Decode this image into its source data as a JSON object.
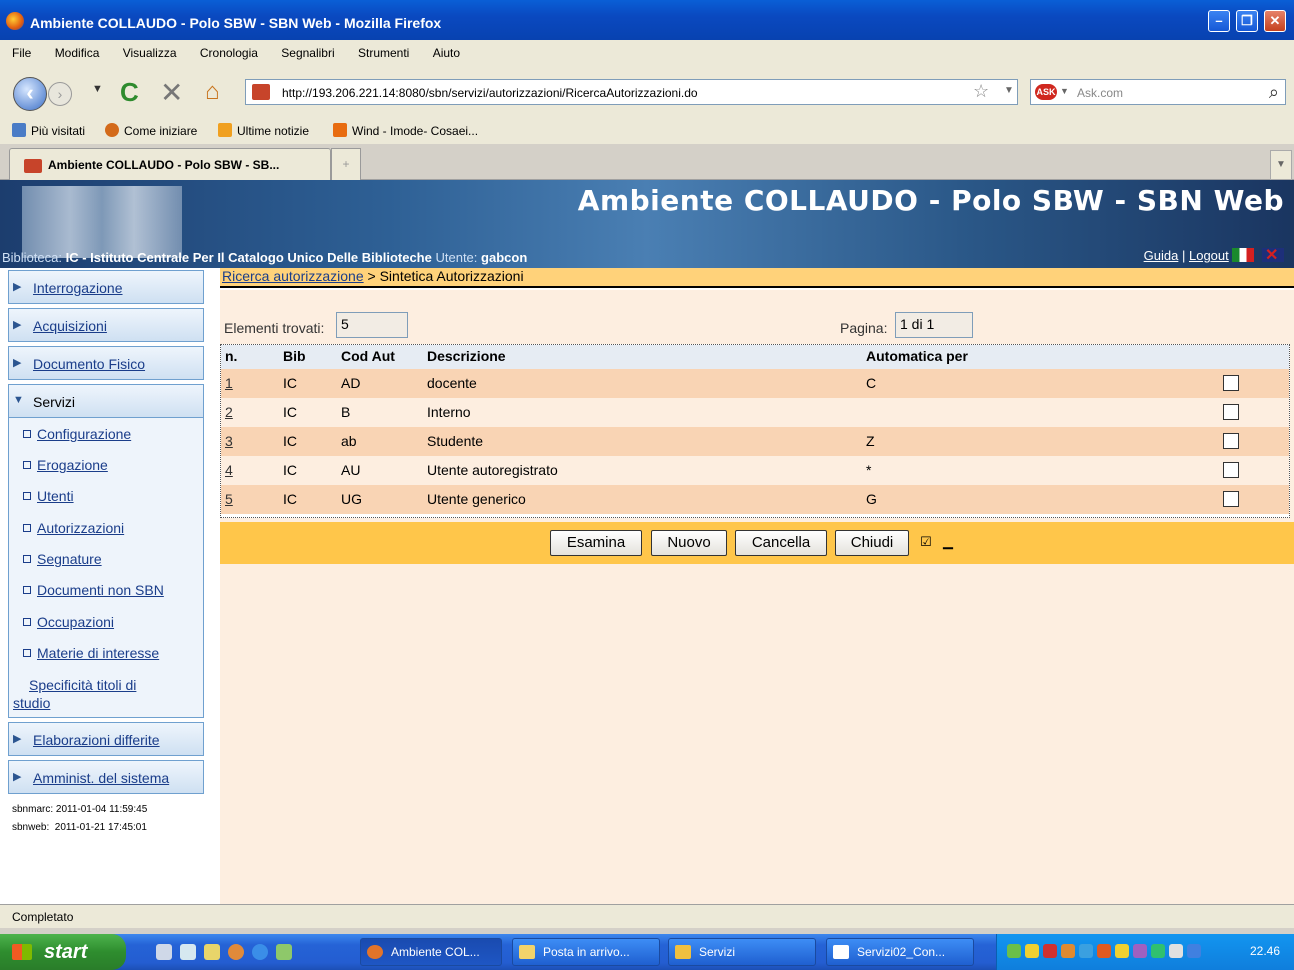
{
  "window": {
    "title": "Ambiente COLLAUDO - Polo SBW - SBN Web - Mozilla Firefox",
    "min": "–",
    "max": "❐",
    "close": "✕"
  },
  "menu": [
    "File",
    "Modifica",
    "Visualizza",
    "Cronologia",
    "Segnalibri",
    "Strumenti",
    "Aiuto"
  ],
  "nav": {
    "url": "http://193.206.221.14:8080/sbn/servizi/autorizzazioni/RicercaAutorizzazioni.do",
    "search_placeholder": "Ask.com",
    "search_logo": "ASK"
  },
  "bookmarks": [
    "Più visitati",
    "Come iniziare",
    "Ultime notizie",
    "Wind - Imode- Cosaei..."
  ],
  "tab": {
    "label": "Ambiente COLLAUDO - Polo SBW - SB...",
    "new": "+"
  },
  "banner": {
    "title": "Ambiente COLLAUDO - Polo SBW - SBN Web",
    "biblioteca_label": "Biblioteca:",
    "biblioteca_code": "IC",
    "biblioteca_name": "- Istituto Centrale Per Il Catalogo Unico Delle Biblioteche",
    "utente_label": "Utente:",
    "utente": "gabcon",
    "guida": "Guida",
    "sep": "|",
    "logout": "Logout"
  },
  "sidebar": {
    "items_top": [
      "Interrogazione",
      "Acquisizioni",
      "Documento Fisico"
    ],
    "servizi": "Servizi",
    "sub": [
      "Configurazione",
      "Erogazione",
      "Utenti",
      "Autorizzazioni",
      "Segnature",
      "Documenti non SBN",
      "Occupazioni",
      "Materie di interesse"
    ],
    "sub_multi_1": "Specificità titoli di",
    "sub_multi_2": "studio",
    "items_bottom": [
      "Elaborazioni differite",
      "Amminist. del sistema"
    ],
    "versions": [
      "sbnmarc: 2011-01-04 11:59:45",
      "sbnweb:  2011-01-21 17:45:01"
    ]
  },
  "breadcrumb": {
    "link": "Ricerca autorizzazione",
    "sep": ">",
    "current": "Sintetica Autorizzazioni"
  },
  "results": {
    "found_label": "Elementi trovati:",
    "found": "5",
    "page_label": "Pagina:",
    "page": "1 di 1"
  },
  "table": {
    "headers": [
      "n.",
      "Bib",
      "Cod Aut",
      "Descrizione",
      "Automatica per"
    ],
    "rows": [
      [
        "1",
        "IC",
        "AD",
        "docente",
        "C"
      ],
      [
        "2",
        "IC",
        "B",
        "Interno",
        ""
      ],
      [
        "3",
        "IC",
        "ab",
        "Studente",
        "Z"
      ],
      [
        "4",
        "IC",
        "AU",
        "Utente autoregistrato",
        "*"
      ],
      [
        "5",
        "IC",
        "UG",
        "Utente generico",
        "G"
      ]
    ]
  },
  "buttons": {
    "esamina": "Esamina",
    "nuovo": "Nuovo",
    "cancella": "Cancella",
    "chiudi": "Chiudi"
  },
  "status": "Completato",
  "taskbar": {
    "start": "start",
    "tasks": [
      "Ambiente COL...",
      "Posta in arrivo...",
      "Servizi",
      "Servizi02_Con..."
    ],
    "clock": "22.46"
  }
}
